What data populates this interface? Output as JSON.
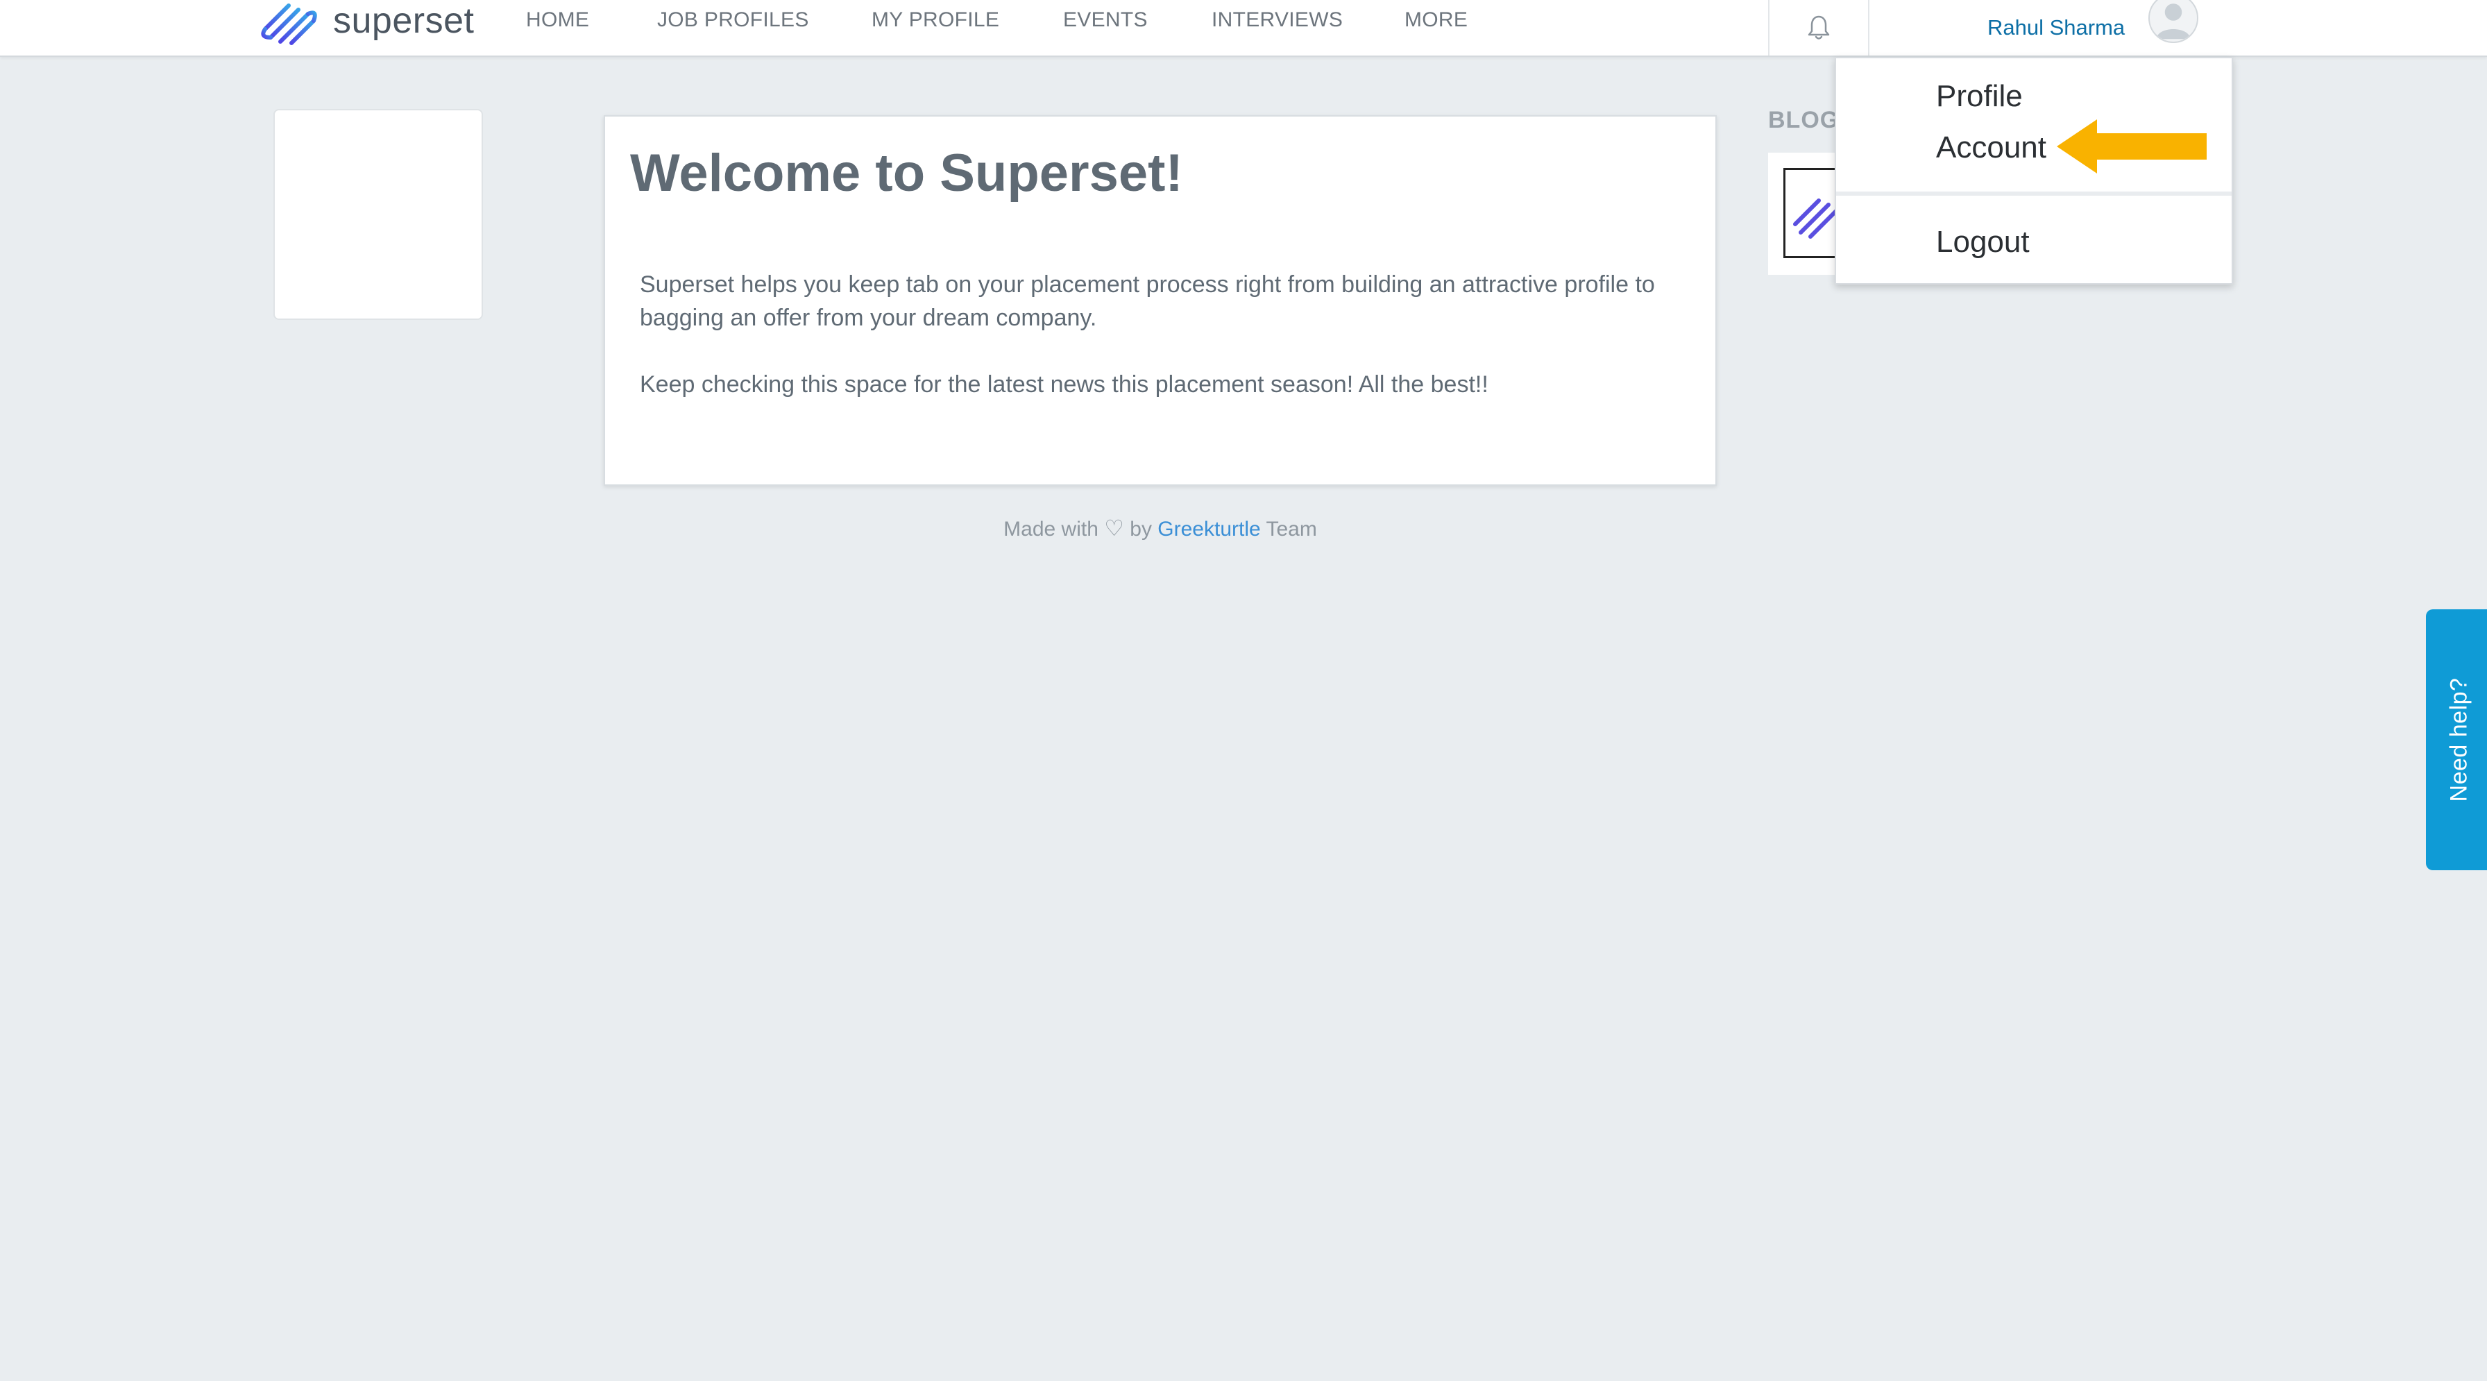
{
  "header": {
    "logo_text": "superset",
    "nav": [
      "HOME",
      "JOB PROFILES",
      "MY PROFILE",
      "EVENTS",
      "INTERVIEWS",
      "MORE"
    ],
    "user_name": "Rahul Sharma"
  },
  "main": {
    "title": "Welcome to Superset!",
    "paragraph1": "Superset helps you keep tab on your placement process right from building an attractive profile to bagging an offer from your dream company.",
    "paragraph2": "Keep checking this space for the latest news this placement season! All the best!!"
  },
  "footer": {
    "prefix": "Made with",
    "heart": "♡",
    "by": "by",
    "link": "Greekturtle",
    "suffix": "Team"
  },
  "blog": {
    "label": "BLOG"
  },
  "user_menu": {
    "items": [
      "Profile",
      "Account",
      "Logout"
    ]
  },
  "help": {
    "label": "Need help?"
  },
  "colors": {
    "accent_blue": "#0d6fa6",
    "help_tab": "#0f9bd6",
    "arrow": "#f9b200",
    "background": "#e9edf0"
  }
}
